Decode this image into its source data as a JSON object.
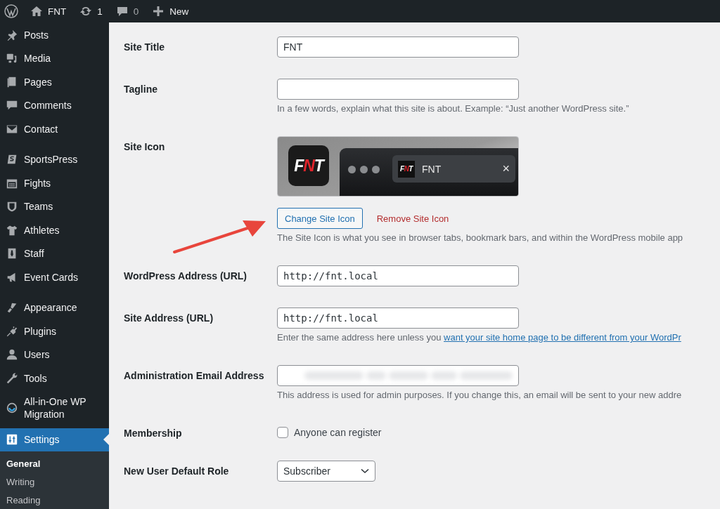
{
  "admin_bar": {
    "items": [
      {
        "kind": "logo"
      },
      {
        "kind": "home",
        "label": "FNT"
      },
      {
        "kind": "updates",
        "label": "1"
      },
      {
        "kind": "comments",
        "label": "0"
      },
      {
        "kind": "new",
        "label": "New"
      }
    ]
  },
  "sidebar": {
    "sections": [
      [
        {
          "label": "Posts",
          "selected": false
        },
        {
          "label": "Media",
          "selected": false
        },
        {
          "label": "Pages",
          "selected": false
        },
        {
          "label": "Comments",
          "selected": false
        },
        {
          "label": "Contact",
          "selected": false
        }
      ],
      [
        {
          "label": "SportsPress",
          "selected": false
        },
        {
          "label": "Fights",
          "selected": false
        },
        {
          "label": "Teams",
          "selected": false
        },
        {
          "label": "Athletes",
          "selected": false
        },
        {
          "label": "Staff",
          "selected": false
        },
        {
          "label": "Event Cards",
          "selected": false
        }
      ],
      [
        {
          "label": "Appearance",
          "selected": false
        },
        {
          "label": "Plugins",
          "selected": false
        },
        {
          "label": "Users",
          "selected": false
        },
        {
          "label": "Tools",
          "selected": false
        },
        {
          "label": "All-in-One WP Migration",
          "selected": false
        },
        {
          "label": "Settings",
          "selected": true
        }
      ]
    ],
    "submenu": [
      {
        "label": "General",
        "selected": true
      },
      {
        "label": "Writing",
        "selected": false
      },
      {
        "label": "Reading",
        "selected": false
      }
    ]
  },
  "form": {
    "rows": [
      {
        "kind": "text",
        "label": "Site Title",
        "value": "FNT"
      },
      {
        "kind": "text",
        "label": "Tagline",
        "description": "In a few words, explain what this site is about. Example: “Just another WordPress site.”"
      },
      {
        "kind": "icon",
        "label": "Site Icon",
        "app_logo": [
          {
            "letter": "F",
            "color": "#ffffff"
          },
          {
            "letter": "N",
            "color": "#e0242b"
          },
          {
            "letter": "T",
            "color": "#ffffff"
          }
        ],
        "tab_logo": [
          {
            "letter": "F",
            "color": "#ffffff"
          },
          {
            "letter": "N",
            "color": "#e0242b"
          },
          {
            "letter": "T",
            "color": "#ffffff"
          }
        ],
        "tab_title": "FNT",
        "tab_close": "×",
        "change_button": "Change Site Icon",
        "remove_link": "Remove Site Icon",
        "description": "The Site Icon is what you see in browser tabs, bookmark bars, and within the WordPress mobile app"
      },
      {
        "kind": "url",
        "label": "WordPress Address (URL)",
        "value": "http://fnt.local"
      },
      {
        "kind": "url",
        "label": "Site Address (URL)",
        "value": "http://fnt.local",
        "description": "Enter the same address here unless you",
        "link": "want your site home page to be different from your WordPr"
      },
      {
        "kind": "redacted",
        "label": "Administration Email Address",
        "description": "This address is used for admin purposes. If you change this, an email will be sent to your new addre"
      },
      {
        "kind": "checkbox",
        "label": "Membership",
        "option": "Anyone can register",
        "checked": false
      },
      {
        "kind": "select",
        "label": "New User Default Role",
        "value": "Subscriber"
      }
    ]
  }
}
